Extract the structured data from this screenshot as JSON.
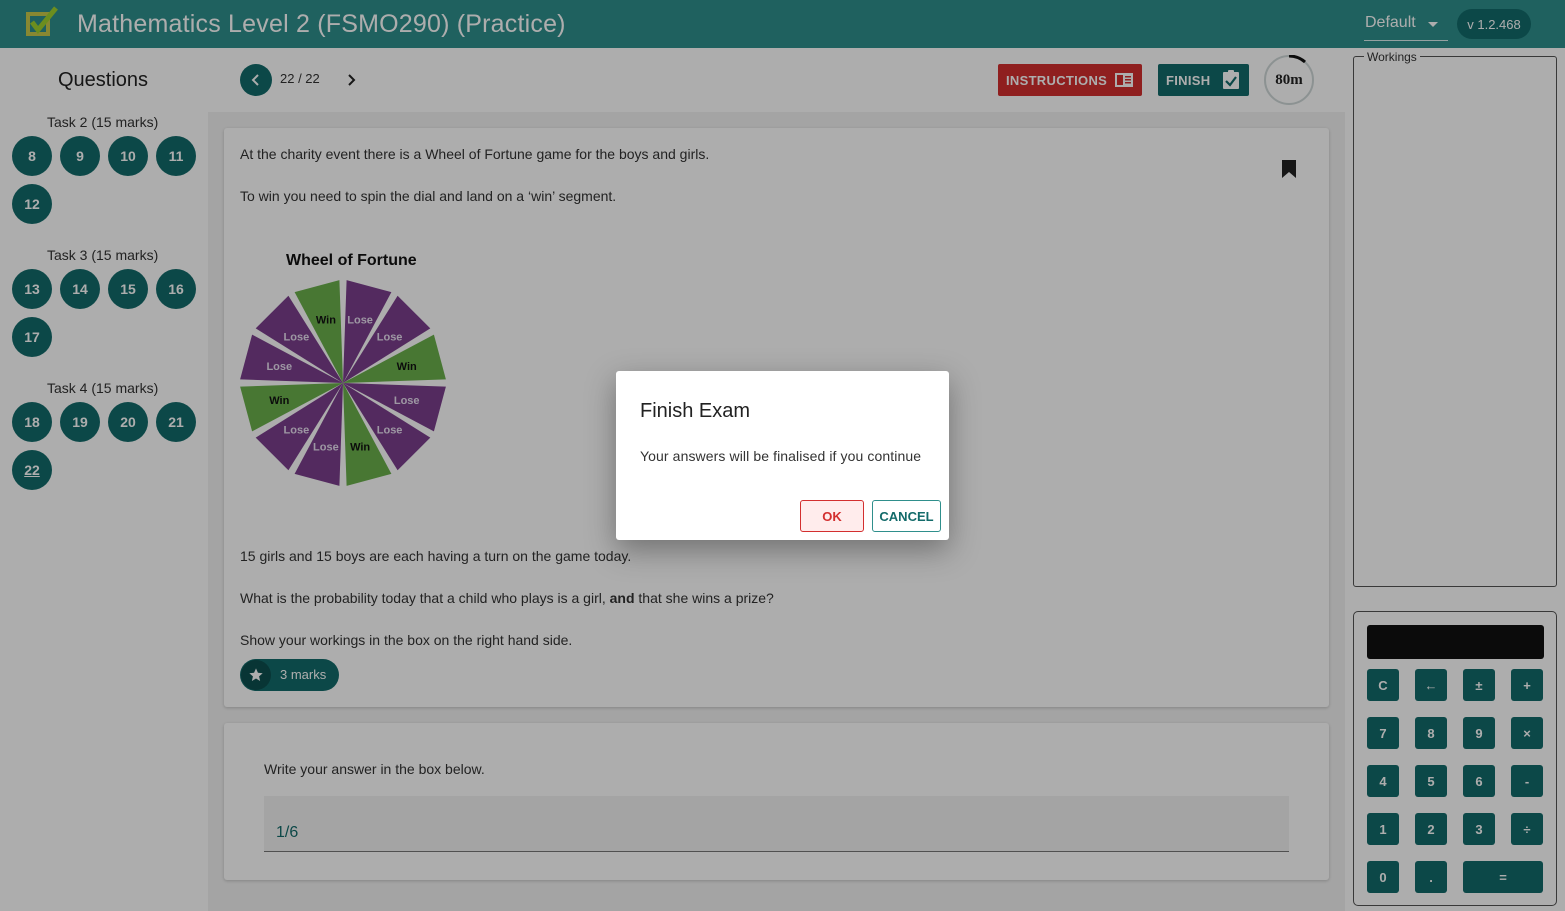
{
  "header": {
    "title": "Mathematics Level 2 (FSMO290) (Practice)",
    "theme_selected": "Default",
    "version": "v 1.2.468"
  },
  "sidebar": {
    "heading": "Questions",
    "tasks": [
      {
        "label": "Task 2 (15 marks)",
        "questions": [
          "8",
          "9",
          "10",
          "11",
          "12"
        ]
      },
      {
        "label": "Task 3 (15 marks)",
        "questions": [
          "13",
          "14",
          "15",
          "16",
          "17"
        ]
      },
      {
        "label": "Task 4 (15 marks)",
        "questions": [
          "18",
          "19",
          "20",
          "21",
          "22"
        ]
      }
    ],
    "current_question": "22"
  },
  "toolbar": {
    "page_indicator": "22 / 22",
    "instructions_label": "INSTRUCTIONS",
    "finish_label": "FINISH",
    "timer_label": "80m"
  },
  "question": {
    "line1": "At the charity event there is a Wheel of Fortune game for the boys and girls.",
    "line2": "To win you need to spin the dial and land on a ‘win’ segment.",
    "wheel_title": "Wheel of Fortune",
    "wheel_segments": [
      "Lose",
      "Lose",
      "Win",
      "Lose",
      "Lose",
      "Win",
      "Lose",
      "Lose",
      "Win",
      "Lose",
      "Lose",
      "Win"
    ],
    "line3": "15 girls and 15 boys are each having a turn on the game today.",
    "line4_pre": "What is the probability today that a child who plays is a girl, ",
    "line4_bold": "and",
    "line4_post": " that she wins a prize?",
    "line5": "Show your workings in the box on the right hand side.",
    "marks": "3 marks"
  },
  "answer": {
    "prompt": "Write your answer in the box below.",
    "value": "1/6"
  },
  "workings": {
    "legend": "Workings"
  },
  "calculator": {
    "keys": [
      [
        "C",
        "←",
        "±",
        "+"
      ],
      [
        "7",
        "8",
        "9",
        "×"
      ],
      [
        "4",
        "5",
        "6",
        "-"
      ],
      [
        "1",
        "2",
        "3",
        "÷"
      ],
      [
        "0",
        ".",
        "="
      ]
    ]
  },
  "dialog": {
    "title": "Finish Exam",
    "message": "Your answers will be finalised if you continue",
    "ok_label": "OK",
    "cancel_label": "CANCEL"
  },
  "colors": {
    "header": "#2f8f8c",
    "primary": "#136b6a",
    "danger": "#d32f2f",
    "win_segment": "#6ab04c",
    "lose_segment": "#7b3f8c"
  }
}
